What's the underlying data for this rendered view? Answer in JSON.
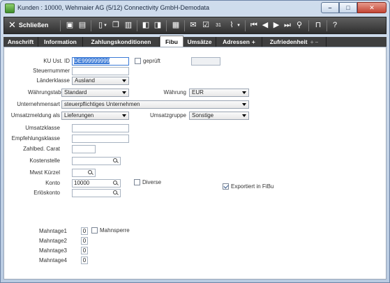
{
  "window": {
    "title": "Kunden : 10000, Wehmaier AG (5/12) Connectivity GmbH-Demodata",
    "minimize": "–",
    "maximize": "□",
    "close": "✕"
  },
  "toolbar": {
    "close_label": "Schließen",
    "close_glyph": "✕"
  },
  "tabs": [
    {
      "label": "Anschrift"
    },
    {
      "label": "Information"
    },
    {
      "label": "Zahlungskonditionen"
    },
    {
      "label": "Fibu"
    },
    {
      "label": "Umsätze"
    },
    {
      "label": "Adressen",
      "plus": "+"
    },
    {
      "label": "Zufriedenheit",
      "plus": "+",
      "minus": "–"
    }
  ],
  "form": {
    "ku_ust_id": {
      "label": "KU Ust. ID",
      "value": "DE999999999"
    },
    "geprueft": {
      "label": "geprüft",
      "checked": false
    },
    "steuernummer": {
      "label": "Steuernummer",
      "value": ""
    },
    "laenderklasse": {
      "label": "Länderklasse",
      "value": "Ausland"
    },
    "waehrungstabelle": {
      "label": "Währungstabelle",
      "value": "Standard"
    },
    "waehrung": {
      "label": "Währung",
      "value": "EUR"
    },
    "unternehmensart": {
      "label": "Unternehmensart",
      "value": "steuerpflichtiges Unternehmen"
    },
    "umsatzmeldung": {
      "label": "Umsatzmeldung als",
      "value": "Lieferungen"
    },
    "umsatzgruppe": {
      "label": "Umsatzgruppe",
      "value": "Sonstige"
    },
    "umsatzklasse": {
      "label": "Umsatzklasse",
      "value": ""
    },
    "empfehlungsklasse": {
      "label": "Empfehlungsklasse",
      "value": ""
    },
    "zahlbed_carat": {
      "label": "Zahlbed. Carat",
      "value": ""
    },
    "kostenstelle": {
      "label": "Kostenstelle",
      "value": ""
    },
    "mwst_kuerzel": {
      "label": "Mwst Kürzel",
      "value": ""
    },
    "konto": {
      "label": "Konto",
      "value": "10000"
    },
    "diverse": {
      "label": "Diverse",
      "checked": false
    },
    "exportiert": {
      "label": "Exportiert in FiBu",
      "checked": true
    },
    "erloeskonto": {
      "label": "Erlöskonto",
      "value": ""
    },
    "mahntage1": {
      "label": "Mahntage1",
      "value": "0"
    },
    "mahnsperre": {
      "label": "Mahnsperre",
      "checked": false
    },
    "mahntage2": {
      "label": "Mahntage2",
      "value": "0"
    },
    "mahntage3": {
      "label": "Mahntage3",
      "value": "0"
    },
    "mahntage4": {
      "label": "Mahntage4",
      "value": "0"
    }
  }
}
